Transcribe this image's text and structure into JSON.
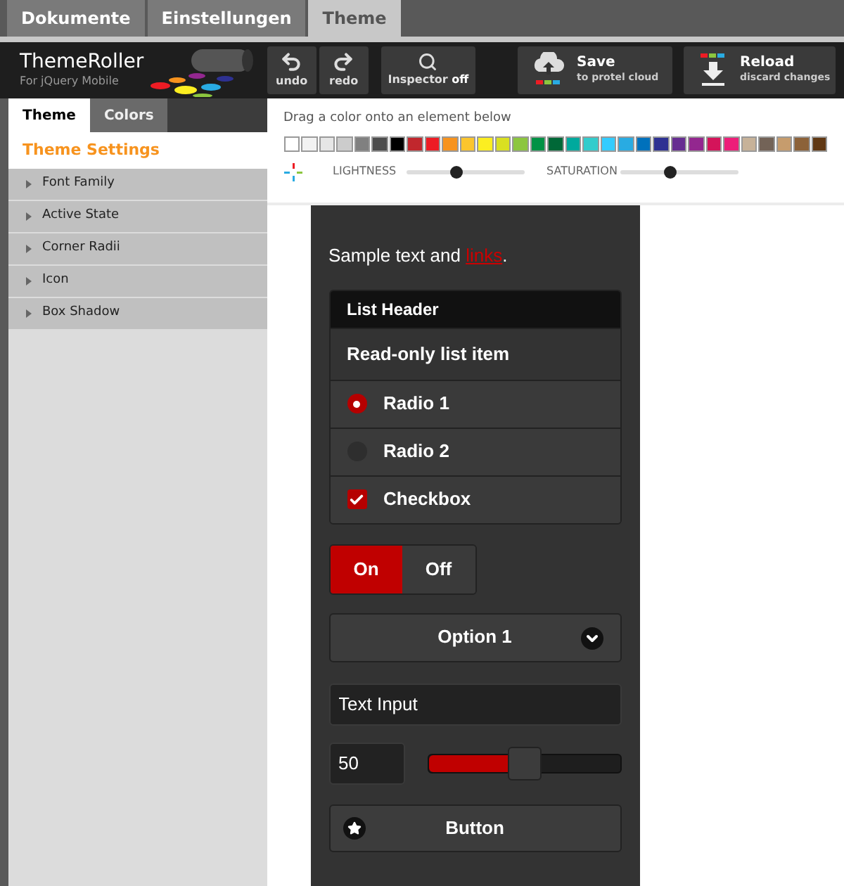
{
  "top_tabs": [
    {
      "label": "Dokumente",
      "selected": false
    },
    {
      "label": "Einstellungen",
      "selected": false
    },
    {
      "label": "Theme",
      "selected": true
    }
  ],
  "toolbar": {
    "logo_title": "ThemeRoller",
    "logo_subtitle": "For jQuery Mobile",
    "history_buttons": [
      {
        "kind": "undo",
        "label": "undo"
      },
      {
        "kind": "redo",
        "label": "redo"
      }
    ],
    "inspector": {
      "label": "Inspector",
      "state": "off",
      "on": false
    },
    "actions": [
      {
        "kind": "save",
        "title": "Save",
        "subtitle": "to protel cloud"
      },
      {
        "kind": "reload",
        "title": "Reload",
        "subtitle": "discard changes"
      }
    ]
  },
  "sidebar": {
    "tabs": [
      {
        "label": "Theme",
        "selected": true
      },
      {
        "label": "Colors",
        "selected": false
      }
    ],
    "heading": "Theme Settings",
    "items": [
      {
        "label": "Font Family",
        "expanded": false
      },
      {
        "label": "Active State",
        "expanded": false
      },
      {
        "label": "Corner Radii",
        "expanded": false
      },
      {
        "label": "Icon",
        "expanded": false
      },
      {
        "label": "Box Shadow",
        "expanded": false
      }
    ]
  },
  "palette": {
    "hint": "Drag a color onto an element below",
    "swatches": [
      {
        "color": "#ffffff"
      },
      {
        "color": "#f2f2f2"
      },
      {
        "color": "#e6e6e6"
      },
      {
        "color": "#cccccc"
      },
      {
        "color": "#808080"
      },
      {
        "color": "#4d4d4d"
      },
      {
        "color": "#000000"
      },
      {
        "color": "#c1272d"
      },
      {
        "color": "#ed1c24"
      },
      {
        "color": "#f7931e"
      },
      {
        "color": "#fbc52d"
      },
      {
        "color": "#fcee21"
      },
      {
        "color": "#d9e021"
      },
      {
        "color": "#8cc63f"
      },
      {
        "color": "#009245"
      },
      {
        "color": "#006837"
      },
      {
        "color": "#00a99d"
      },
      {
        "color": "#33cccc"
      },
      {
        "color": "#33ccff"
      },
      {
        "color": "#29abe2"
      },
      {
        "color": "#0071bc"
      },
      {
        "color": "#2e3192"
      },
      {
        "color": "#662d91"
      },
      {
        "color": "#93278f"
      },
      {
        "color": "#d4145a"
      },
      {
        "color": "#ed1e79"
      },
      {
        "color": "#c7b299"
      },
      {
        "color": "#736357"
      },
      {
        "color": "#c69c6d"
      },
      {
        "color": "#8c6239"
      },
      {
        "color": "#603813"
      }
    ],
    "sliders": [
      {
        "label": "LIGHTNESS",
        "level": 0.42
      },
      {
        "label": "SATURATION",
        "level": 0.42
      }
    ]
  },
  "preview": {
    "sample_text": "Sample text and ",
    "sample_link": "links",
    "sample_end": ".",
    "list": {
      "header": "List Header",
      "items": [
        {
          "kind": "text",
          "label": "Read-only list item"
        },
        {
          "kind": "radio",
          "label": "Radio 1",
          "checked": true
        },
        {
          "kind": "radio",
          "label": "Radio 2",
          "checked": false
        },
        {
          "kind": "checkbox",
          "label": "Checkbox",
          "checked": true
        }
      ]
    },
    "toggle": [
      {
        "label": "On",
        "selected": true
      },
      {
        "label": "Off",
        "selected": false
      }
    ],
    "select": {
      "value": "Option 1"
    },
    "text_input": {
      "value": "Text Input"
    },
    "slider": {
      "value": "50",
      "level": 0.5
    },
    "button": {
      "label": "Button"
    }
  }
}
